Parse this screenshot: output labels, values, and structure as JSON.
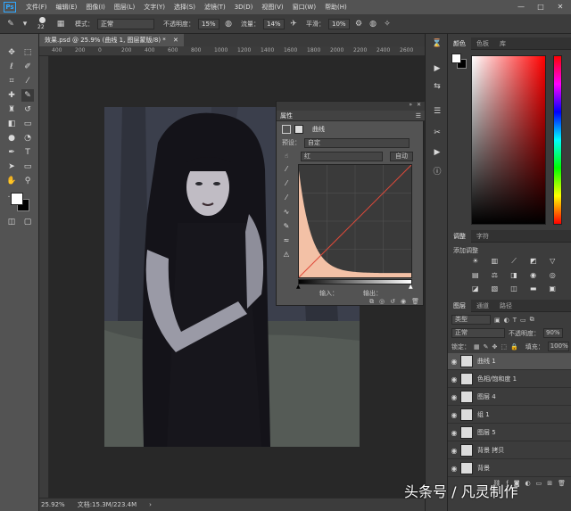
{
  "menubar": {
    "logo": "Ps",
    "items": [
      "文件(F)",
      "编辑(E)",
      "图像(I)",
      "图层(L)",
      "文字(Y)",
      "选择(S)",
      "滤镜(T)",
      "3D(D)",
      "视图(V)",
      "窗口(W)",
      "帮助(H)"
    ],
    "window_controls": [
      "—",
      "□",
      "✕"
    ]
  },
  "options_bar": {
    "brush_size": "22",
    "mode_label": "模式：",
    "mode_value": "正常",
    "opacity_label": "不透明度：",
    "opacity_value": "15%",
    "flow_label": "流量：",
    "flow_value": "14%",
    "smoothing_label": "平滑：",
    "smoothing_value": "10%"
  },
  "document": {
    "tab_title": "效果.psd @ 25.9% (曲线 1, 图层蒙版/8) *",
    "ruler_ticks": [
      "400",
      "200",
      "0",
      "200",
      "400",
      "600",
      "800",
      "1000",
      "1200",
      "1400",
      "1600",
      "1800",
      "2000",
      "2200",
      "2400",
      "2600"
    ]
  },
  "status": {
    "zoom": "25.92%",
    "doc_size": "文档:15.3M/223.4M"
  },
  "properties_panel": {
    "title": "属性",
    "adjustment_name": "曲线",
    "preset_label": "预设：",
    "preset_value": "自定",
    "channel_value": "红",
    "auto_button": "自动",
    "input_label": "输入：",
    "output_label": "输出：",
    "channel": "red",
    "curve_points": [
      [
        0,
        0
      ],
      [
        255,
        255
      ]
    ],
    "histogram_peak_fraction": 0.95
  },
  "color_panel": {
    "tabs": [
      "颜色",
      "色板",
      "库"
    ],
    "foreground": "#ffffff",
    "background": "#000000",
    "hue": "#ff0000"
  },
  "adjustments_panel": {
    "tabs": [
      "调整",
      "字符"
    ],
    "add_label": "添加调整"
  },
  "layers_panel": {
    "tabs": [
      "图层",
      "通道",
      "路径"
    ],
    "filter_value": "类型",
    "blend_mode": "正常",
    "opacity_label": "不透明度：",
    "opacity_value": "90%",
    "lock_label": "锁定：",
    "fill_label": "填充：",
    "fill_value": "100%",
    "layers": [
      {
        "name": "曲线 1",
        "selected": true
      },
      {
        "name": "色相/饱和度 1",
        "selected": false
      },
      {
        "name": "图层 4",
        "selected": false
      },
      {
        "name": "组 1",
        "selected": false
      },
      {
        "name": "图层 5",
        "selected": false
      },
      {
        "name": "背景 拷贝",
        "selected": false
      },
      {
        "name": "背景",
        "selected": false
      }
    ]
  },
  "watermark": "头条号 / 凡灵制作"
}
